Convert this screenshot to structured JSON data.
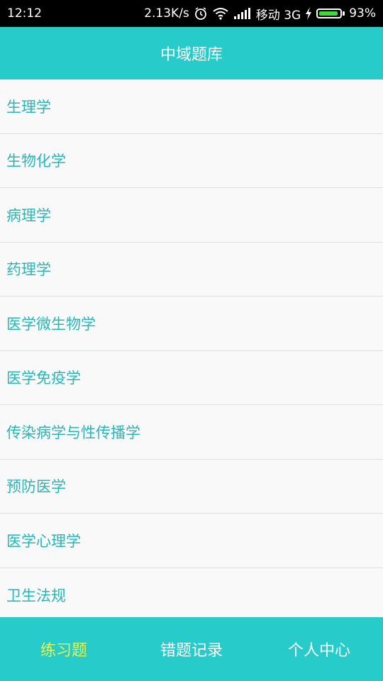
{
  "status_bar": {
    "time": "12:12",
    "net_speed": "2.13K/s",
    "icons": [
      "alarm-icon",
      "wifi-icon",
      "signal-icon",
      "charging-icon",
      "battery-icon"
    ],
    "carrier": "移动 3G",
    "battery_percent": "93%",
    "battery_level": 0.93
  },
  "header": {
    "title": "中域题库"
  },
  "subjects": [
    {
      "label": "生理学"
    },
    {
      "label": "生物化学"
    },
    {
      "label": "病理学"
    },
    {
      "label": "药理学"
    },
    {
      "label": "医学微生物学"
    },
    {
      "label": "医学免疫学"
    },
    {
      "label": "传染病学与性传播学"
    },
    {
      "label": "预防医学"
    },
    {
      "label": "医学心理学"
    },
    {
      "label": "卫生法规"
    }
  ],
  "bottom_nav": {
    "tabs": [
      {
        "label": "练习题",
        "active": true
      },
      {
        "label": "错题记录",
        "active": false
      },
      {
        "label": "个人中心",
        "active": false
      }
    ]
  },
  "colors": {
    "accent": "#27cbc9",
    "item_text": "#2bb5b6",
    "active_tab": "#e8f54a",
    "battery_fill": "#3ed93a"
  }
}
